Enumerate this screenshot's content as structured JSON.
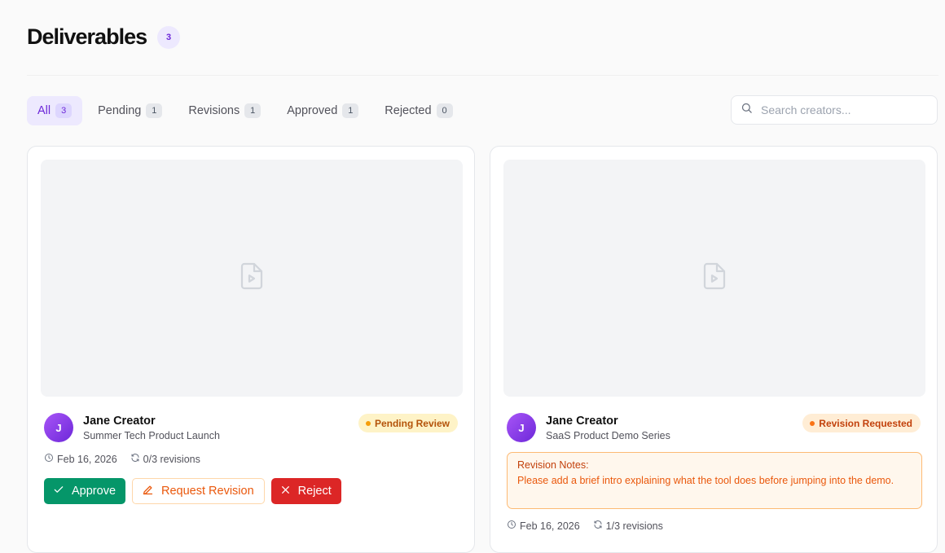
{
  "page": {
    "title": "Deliverables",
    "count": "3"
  },
  "tabs": [
    {
      "label": "All",
      "count": "3",
      "active": true
    },
    {
      "label": "Pending",
      "count": "1"
    },
    {
      "label": "Revisions",
      "count": "1"
    },
    {
      "label": "Approved",
      "count": "1"
    },
    {
      "label": "Rejected",
      "count": "0"
    }
  ],
  "search": {
    "placeholder": "Search creators...",
    "value": ""
  },
  "cards": [
    {
      "avatar_initial": "J",
      "creator": "Jane Creator",
      "campaign": "Summer Tech Product Launch",
      "status": "Pending Review",
      "date": "Feb 16, 2026",
      "revisions": "0/3 revisions",
      "thumbnail_icon": "file-video-icon",
      "actions": {
        "approve": "Approve",
        "request_revision": "Request Revision",
        "reject": "Reject"
      }
    },
    {
      "avatar_initial": "J",
      "creator": "Jane Creator",
      "campaign": "SaaS Product Demo Series",
      "status": "Revision Requested",
      "date": "Feb 16, 2026",
      "revisions": "1/3 revisions",
      "thumbnail_icon": "file-video-icon",
      "notes_label": "Revision Notes:",
      "notes_text": "Please add a brief intro explaining what the tool does before jumping into the demo."
    }
  ],
  "colors": {
    "accent": "#6d28d9",
    "approve": "#059669",
    "reject": "#dc2626",
    "pending": "#b45309",
    "revision": "#c2410c"
  }
}
